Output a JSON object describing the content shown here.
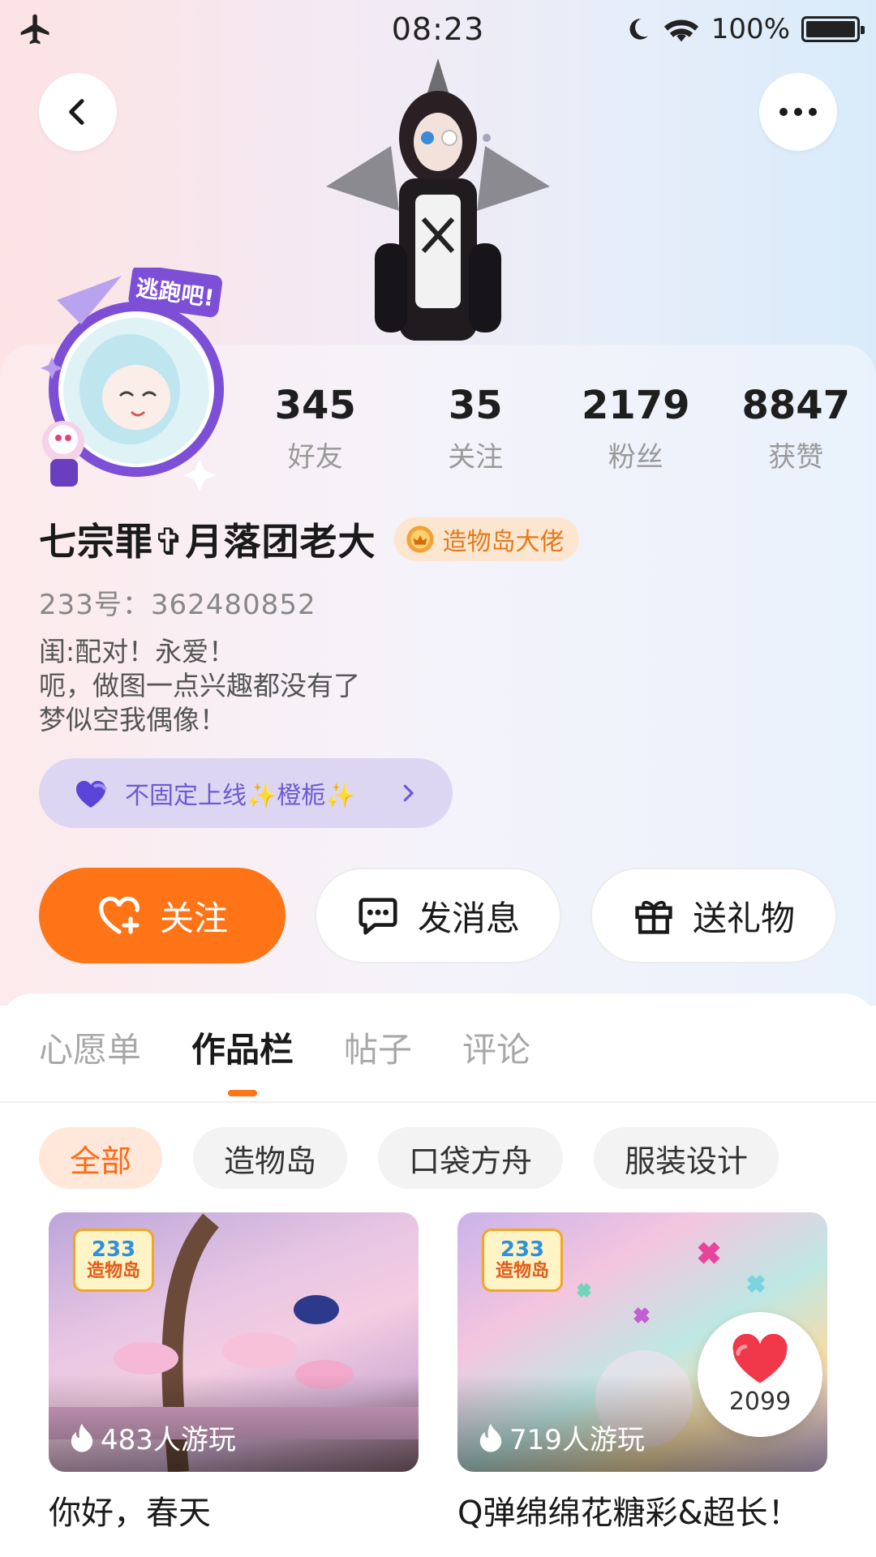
{
  "status_bar": {
    "time": "08:23",
    "battery": "100%"
  },
  "profile": {
    "stats": [
      {
        "value": "345",
        "label": "好友"
      },
      {
        "value": "35",
        "label": "关注"
      },
      {
        "value": "2179",
        "label": "粉丝"
      },
      {
        "value": "8847",
        "label": "获赞"
      }
    ],
    "username": "七宗罪✞月落团老大",
    "badge": "造物岛大佬",
    "uid": "233号：362480852",
    "bio": [
      "闺:配对！永爱！",
      "呃，做图一点兴趣都没有了",
      "梦似空我偶像！"
    ],
    "status": "不固定上线✨橙栀✨",
    "avatar_sticker": "逃跑吧!"
  },
  "actions": {
    "follow": "关注",
    "message": "发消息",
    "gift": "送礼物"
  },
  "tabs": [
    "心愿单",
    "作品栏",
    "帖子",
    "评论"
  ],
  "filters": [
    "全部",
    "造物岛",
    "口袋方舟",
    "服装设计"
  ],
  "works": [
    {
      "logo_top": "233",
      "logo_bottom": "造物岛",
      "plays": "483人游玩",
      "title": "你好，春天"
    },
    {
      "logo_top": "233",
      "logo_bottom": "造物岛",
      "plays": "719人游玩",
      "title": "Q弹绵绵花糖彩&超长！"
    }
  ],
  "like_bubble": {
    "count": "2099"
  },
  "colors": {
    "accent": "#ff7417",
    "status_pill": "#dcd6f3",
    "status_text": "#6d5bd0",
    "badge_bg": "#fde6cf"
  }
}
